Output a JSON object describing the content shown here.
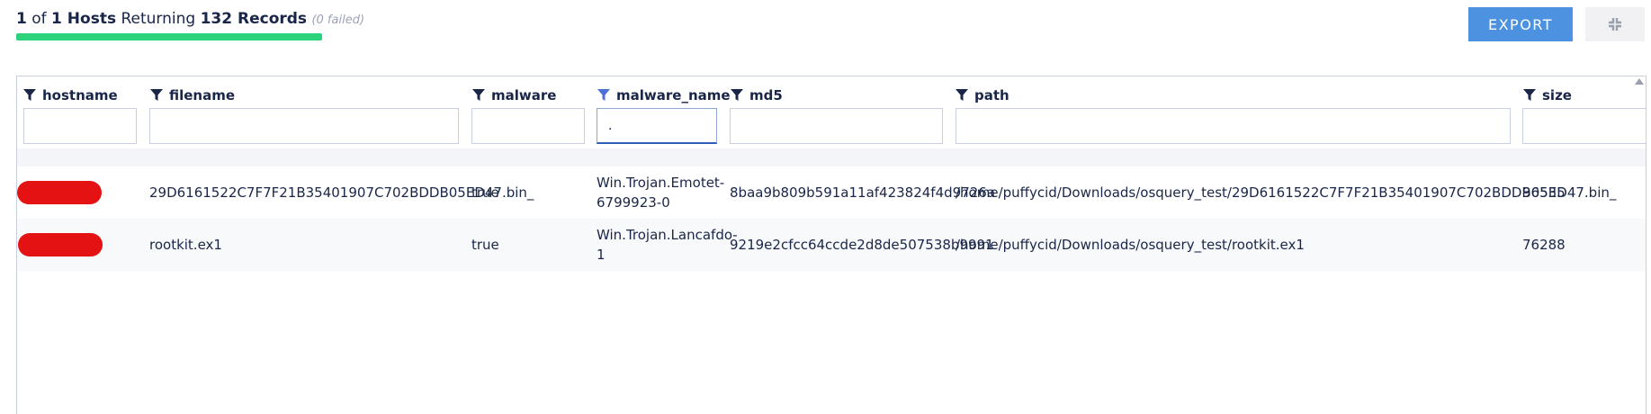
{
  "summary": {
    "hosts_done": "1",
    "of_label": "of",
    "hosts_total": "1 Hosts",
    "returning_label": "Returning",
    "records": "132 Records",
    "failed": "(0 failed)",
    "progress_percent": 100
  },
  "toolbar": {
    "export_label": "EXPORT",
    "collapse_icon": "collapse-arrows-icon"
  },
  "columns": [
    {
      "key": "hostname",
      "label": "hostname",
      "filter_value": "",
      "filter_active": false
    },
    {
      "key": "filename",
      "label": "filename",
      "filter_value": "",
      "filter_active": false
    },
    {
      "key": "malware",
      "label": "malware",
      "filter_value": "",
      "filter_active": false
    },
    {
      "key": "malware_name",
      "label": "malware_name",
      "filter_value": ".",
      "filter_active": true
    },
    {
      "key": "md5",
      "label": "md5",
      "filter_value": "",
      "filter_active": false
    },
    {
      "key": "path",
      "label": "path",
      "filter_value": "",
      "filter_active": false
    },
    {
      "key": "size",
      "label": "size",
      "filter_value": "",
      "filter_active": false
    }
  ],
  "rows": [
    {
      "hostname": "",
      "filename": "29D6161522C7F7F21B35401907C702BDDB05ED47.bin_",
      "malware": "true",
      "malware_name": "Win.Trojan.Emotet-6799923-0",
      "md5": "8baa9b809b591a11af423824f4d9726a",
      "path": "/home/puffycid/Downloads/osquery_test/29D6161522C7F7F21B35401907C702BDDB05ED47.bin_",
      "size": "96535"
    },
    {
      "hostname": "",
      "filename": "rootkit.ex1",
      "malware": "true",
      "malware_name": "Win.Trojan.Lancafdo-1",
      "md5": "9219e2cfcc64ccde2d8de507538b9991",
      "path": "/home/puffycid/Downloads/osquery_test/rootkit.ex1",
      "size": "76288"
    }
  ],
  "colors": {
    "accent": "#4c92e0",
    "progress": "#2dd37c",
    "text": "#192648",
    "redaction": "#e41212",
    "filter_active_icon": "#4c6fd8"
  }
}
